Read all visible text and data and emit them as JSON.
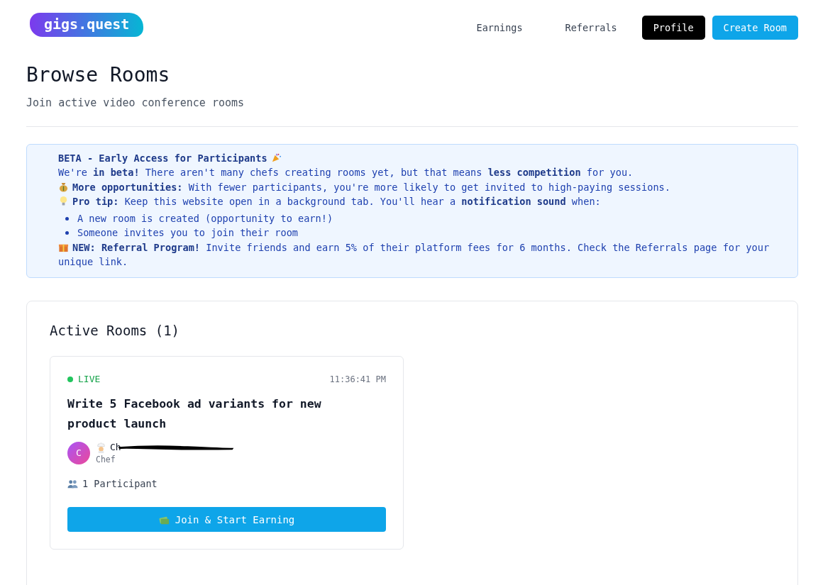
{
  "logo": "gigs.quest",
  "nav": [
    {
      "label": "Earnings",
      "kind": "link"
    },
    {
      "label": "Referrals",
      "kind": "link"
    },
    {
      "label": "Profile",
      "kind": "dark"
    },
    {
      "label": "Create Room",
      "kind": "primary"
    }
  ],
  "page": {
    "title": "Browse Rooms",
    "subtitle": "Join active video conference rooms"
  },
  "banner": {
    "title": "BETA - Early Access for Participants",
    "lines": [
      {
        "kind": "plain",
        "text": "We're **in beta!** There aren't many chefs creating rooms yet, but that means **less competition** for you."
      },
      {
        "kind": "opportunity",
        "text": "**More opportunities:** With fewer participants, you're more likely to get invited to high-paying sessions."
      },
      {
        "kind": "tip",
        "text": "**Pro tip:** Keep this website open in a background tab. You'll hear a **notification sound** when:"
      }
    ],
    "bullets": [
      "A new room is created (opportunity to earn!)",
      "Someone invites you to join their room"
    ],
    "footer": {
      "text": "**NEW: Referral Program!** Invite friends and earn 5% of their platform fees for 6 months. Check the Referrals page for your unique link."
    }
  },
  "rooms_section": {
    "title": "Active Rooms (1)",
    "rooms": [
      {
        "status": "LIVE",
        "time": "11:36:41 PM",
        "title": "Write 5 Facebook ad variants for new product launch",
        "host": {
          "initial": "C",
          "name": "Ch",
          "role": "Chef"
        },
        "participants": "1 Participant",
        "button": "Join & Start Earning"
      }
    ]
  }
}
